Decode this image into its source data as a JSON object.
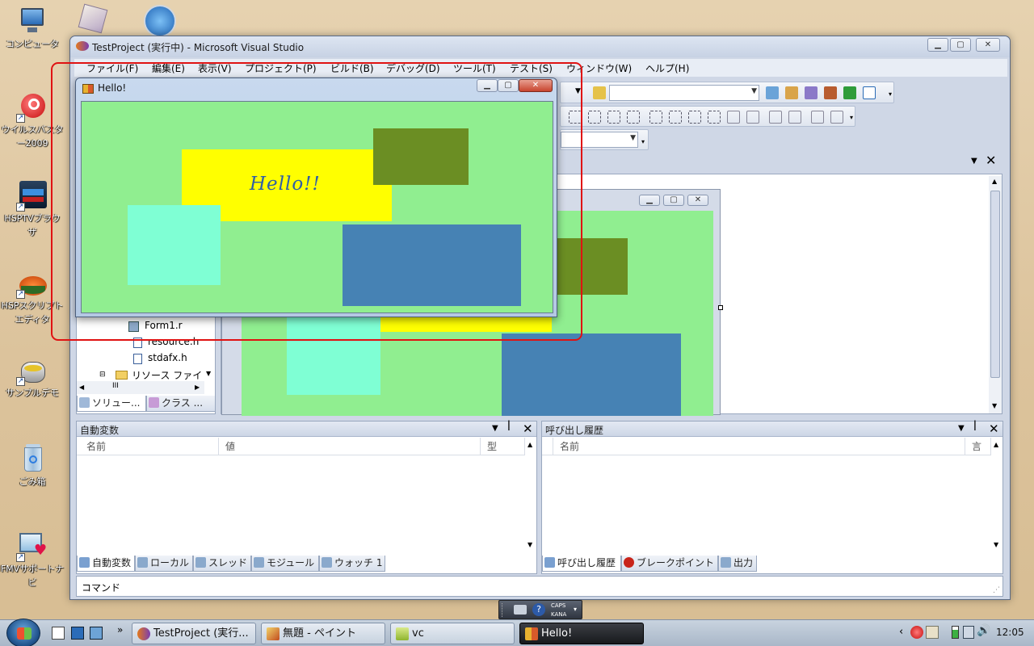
{
  "desktop": {
    "icons": [
      {
        "label": "コンピュータ",
        "icon": "computer-icon"
      },
      {
        "label": "ウイルスバスター2009",
        "icon": "virusbuster-icon"
      },
      {
        "label": "HSPTVブラウザ",
        "icon": "hsptv-icon"
      },
      {
        "label": "HSPスクリプトエディタ",
        "icon": "hsp-editor-icon"
      },
      {
        "label": "サンプルデモ",
        "icon": "sample-demo-icon"
      },
      {
        "label": "ごみ箱",
        "icon": "recycle-bin-icon"
      },
      {
        "label": "FMVサポートナビ",
        "icon": "fmv-support-icon"
      }
    ]
  },
  "vs": {
    "title": "TestProject (実行中) - Microsoft Visual Studio",
    "menu": [
      "ファイル(F)",
      "編集(E)",
      "表示(V)",
      "プロジェクト(P)",
      "ビルド(B)",
      "デバッグ(D)",
      "ツール(T)",
      "テスト(S)",
      "ウィンドウ(W)",
      "ヘルプ(H)"
    ],
    "solution_tree": [
      "Form1.r",
      "resource.h",
      "stdafx.h",
      "リソース ファイ"
    ],
    "solution_tabs": [
      "ソリュー...",
      "クラス ..."
    ],
    "scroll_thumb": "III",
    "autos_panel": {
      "title": "自動変数",
      "columns": [
        "名前",
        "値",
        "型"
      ],
      "tabs": [
        "自動変数",
        "ローカル",
        "スレッド",
        "モジュール",
        "ウォッチ 1"
      ]
    },
    "callstack_panel": {
      "title": "呼び出し履歴",
      "columns": [
        "名前",
        "言語"
      ],
      "tabs": [
        "呼び出し履歴",
        "ブレークポイント",
        "出力"
      ]
    },
    "command_label": "コマンド"
  },
  "hello_window": {
    "title": "Hello!",
    "text": "Hello!!",
    "colors": {
      "background": "#90ee90",
      "yellow": "#ffff00",
      "olive": "#6b8e23",
      "aqua": "#7fffd4",
      "blue": "#4682b4",
      "text": "#2f5fa6"
    }
  },
  "langbar": {
    "caps": "CAPS",
    "kana": "KANA"
  },
  "taskbar": {
    "buttons": [
      {
        "label": "TestProject (実行...",
        "icon": "visual-studio-icon"
      },
      {
        "label": "無題 - ペイント",
        "icon": "paint-icon"
      },
      {
        "label": "vc",
        "icon": "folder-icon"
      },
      {
        "label": "Hello!",
        "icon": "form-app-icon"
      }
    ],
    "clock": "12:05",
    "accent": "#e01212"
  }
}
